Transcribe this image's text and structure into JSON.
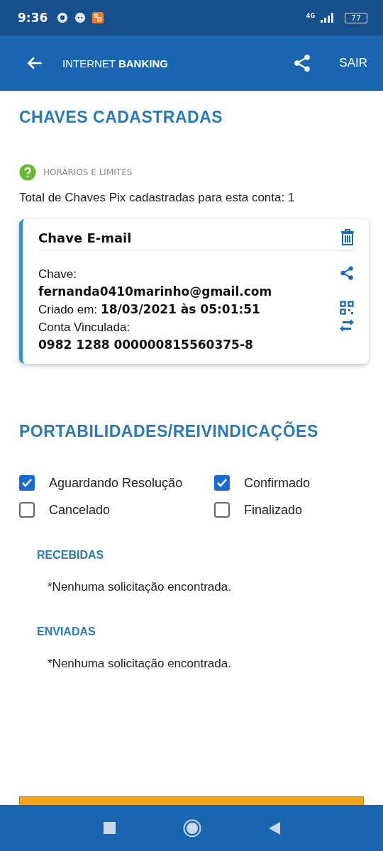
{
  "status_bar": {
    "time": "9:36",
    "network": "4G",
    "battery": "77"
  },
  "app_bar": {
    "title": "INTERNET **BANKING**",
    "action": "SAIR"
  },
  "keys_section": {
    "title": "CHAVES CADASTRADAS",
    "help_link": "HORÁRIOS E LIMITES",
    "total": "Total de Chaves Pix cadastradas para esta conta: 1"
  },
  "key_cards": [
    {
      "title": "Chave E-mail",
      "key_label": "Chave:",
      "key_value": "fernanda0410marinho@gmail.com",
      "created": "Criado em: **18/03/2021 às 05:01:51**",
      "account_label": "Conta Vinculada:",
      "account_value": "0982 1288 000000815560375-8"
    }
  ],
  "claims_section": {
    "title": "PORTABILIDADES/REIVINDICAÇÕES",
    "filters": [
      {
        "label": "Aguardando Resolução",
        "checked": true
      },
      {
        "label": "Confirmado",
        "checked": true
      },
      {
        "label": "Cancelado",
        "checked": false
      },
      {
        "label": "Finalizado",
        "checked": false
      }
    ],
    "lists": [
      {
        "title": "RECEBIDAS",
        "message": "*Nenhuma solicitação encontrada."
      },
      {
        "title": "ENVIADAS",
        "message": "*Nenhuma solicitação encontrada."
      }
    ]
  }
}
